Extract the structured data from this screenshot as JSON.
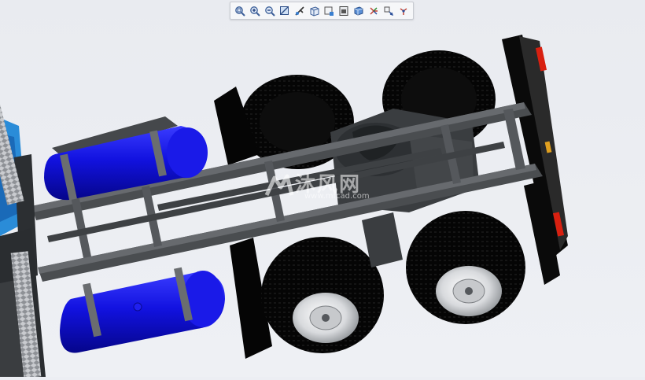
{
  "toolbar": {
    "buttons": [
      {
        "icon": "zoom-fit-icon"
      },
      {
        "icon": "zoom-in-icon"
      },
      {
        "icon": "zoom-out-icon"
      },
      {
        "icon": "zoom-window-icon"
      },
      {
        "icon": "pan-icon"
      },
      {
        "icon": "view-orient-icon"
      },
      {
        "icon": "standard-views-icon"
      },
      {
        "icon": "display-style-icon"
      },
      {
        "icon": "shaded-icon"
      },
      {
        "icon": "spin-center-icon"
      },
      {
        "icon": "named-view-icon"
      },
      {
        "icon": "datum-display-icon"
      }
    ]
  },
  "watermark": {
    "brand": "沐风网",
    "url": "www.mfcad.com"
  },
  "colors": {
    "tank": "#1010d8",
    "frame": "#4a4d50",
    "tire": "#050505",
    "cab": "#2a8cd8",
    "tail_light": "#d82010"
  }
}
